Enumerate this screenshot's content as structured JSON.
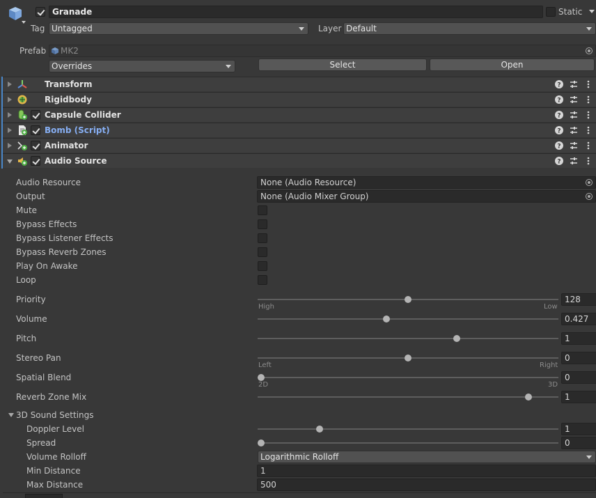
{
  "header": {
    "name": "Granade",
    "active": true,
    "static_label": "Static",
    "tag_label": "Tag",
    "tag_value": "Untagged",
    "layer_label": "Layer",
    "layer_value": "Default",
    "prefab_label": "Prefab",
    "prefab_value": "MK2",
    "overrides_label": "Overrides",
    "select_label": "Select",
    "open_label": "Open"
  },
  "components": [
    {
      "name": "Transform",
      "icon": "transform-icon",
      "has_checkbox": false
    },
    {
      "name": "Rigidbody",
      "icon": "rigidbody-icon",
      "has_checkbox": false
    },
    {
      "name": "Capsule Collider",
      "icon": "capsule-collider-icon",
      "has_checkbox": true
    },
    {
      "name": "Bomb (Script)",
      "icon": "script-icon",
      "has_checkbox": true
    },
    {
      "name": "Animator",
      "icon": "animator-icon",
      "has_checkbox": true
    },
    {
      "name": "Audio Source",
      "icon": "audio-source-icon",
      "has_checkbox": true
    }
  ],
  "audio": {
    "audio_resource_label": "Audio Resource",
    "audio_resource_value": "None (Audio Resource)",
    "output_label": "Output",
    "output_value": "None (Audio Mixer Group)",
    "mute_label": "Mute",
    "bypass_effects_label": "Bypass Effects",
    "bypass_listener_label": "Bypass Listener Effects",
    "bypass_reverb_label": "Bypass Reverb Zones",
    "play_on_awake_label": "Play On Awake",
    "loop_label": "Loop",
    "priority_label": "Priority",
    "priority_value": "128",
    "priority_fraction": 0.5,
    "priority_min_label": "High",
    "priority_max_label": "Low",
    "volume_label": "Volume",
    "volume_value": "0.427",
    "volume_fraction": 0.427,
    "pitch_label": "Pitch",
    "pitch_value": "1",
    "pitch_fraction": 0.667,
    "stereo_pan_label": "Stereo Pan",
    "stereo_pan_value": "0",
    "stereo_pan_fraction": 0.5,
    "stereo_min_label": "Left",
    "stereo_max_label": "Right",
    "spatial_blend_label": "Spatial Blend",
    "spatial_blend_value": "0",
    "spatial_blend_fraction": 0.0,
    "spatial_min_label": "2D",
    "spatial_max_label": "3D",
    "reverb_mix_label": "Reverb Zone Mix",
    "reverb_mix_value": "1",
    "reverb_mix_fraction": 0.909,
    "sound3d_label": "3D Sound Settings",
    "doppler_label": "Doppler Level",
    "doppler_value": "1",
    "doppler_fraction": 0.2,
    "spread_label": "Spread",
    "spread_value": "0",
    "spread_fraction": 0.0,
    "rolloff_label": "Volume Rolloff",
    "rolloff_value": "Logarithmic Rolloff",
    "min_distance_label": "Min Distance",
    "min_distance_value": "1",
    "max_distance_label": "Max Distance",
    "max_distance_value": "500"
  }
}
